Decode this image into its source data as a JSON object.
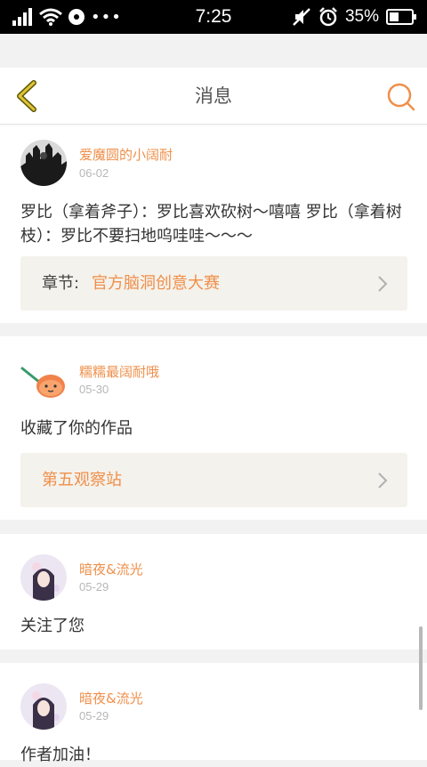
{
  "status_bar": {
    "time": "7:25",
    "battery": "35%"
  },
  "header": {
    "title": "消息"
  },
  "messages": [
    {
      "username": "爱魔圆的小阔耐",
      "date": "06-02",
      "body": "罗比（拿着斧子）：罗比喜欢砍树～嘻嘻 罗比（拿着树枝）：罗比不要扫地呜哇哇～～～",
      "link_label": "章节:",
      "link_value": "官方脑洞创意大赛"
    },
    {
      "username": "糯糯最阔耐哦",
      "date": "05-30",
      "body": "收藏了你的作品",
      "link_value": "第五观察站"
    },
    {
      "username": "暗夜&流光",
      "date": "05-29",
      "body": "关注了您"
    },
    {
      "username": "暗夜&流光",
      "date": "05-29",
      "body": "作者加油！"
    }
  ],
  "colors": {
    "accent": "#ef8f4a",
    "back_arrow": "#d4a017"
  },
  "icons": [
    "back-arrow-icon",
    "search-icon",
    "chevron-right-icon"
  ]
}
